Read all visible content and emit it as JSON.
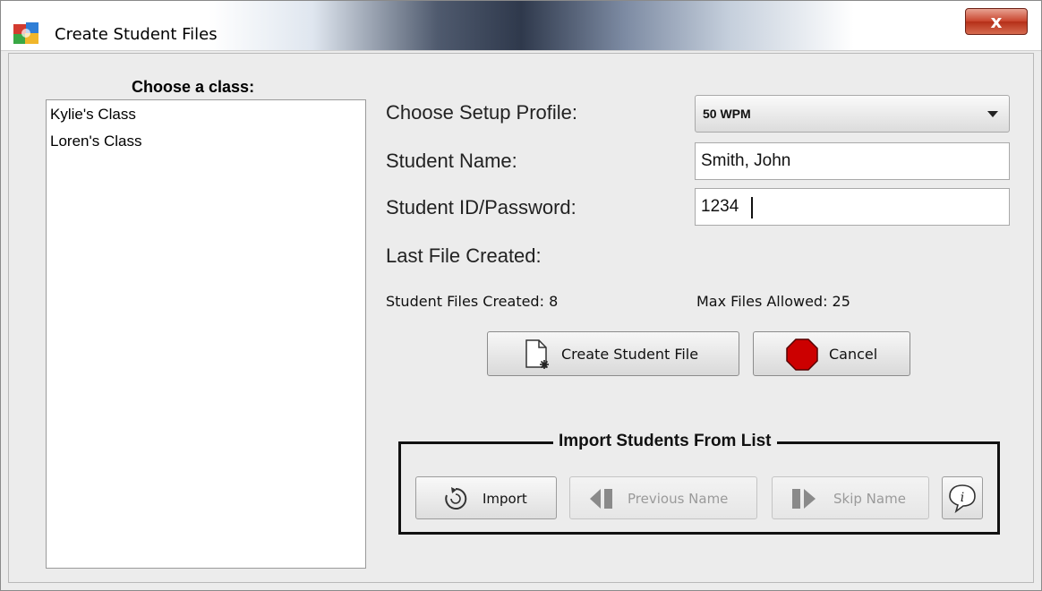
{
  "window": {
    "title": "Create Student Files",
    "close_label": "x"
  },
  "classes": {
    "heading": "Choose a class:",
    "items": [
      "Kylie's Class",
      "Loren's Class"
    ]
  },
  "form": {
    "profile_label": "Choose Setup Profile:",
    "profile_value": "50 WPM",
    "name_label": "Student Name:",
    "name_value": "Smith, John",
    "id_label": "Student ID/Password:",
    "id_value": "1234",
    "last_file_label": "Last File Created:",
    "files_created": "Student Files Created: 8",
    "max_files": "Max Files Allowed: 25"
  },
  "actions": {
    "create_label": "Create Student File",
    "cancel_label": "Cancel"
  },
  "import_group": {
    "title": "Import Students From List",
    "import_label": "Import",
    "previous_label": "Previous Name",
    "skip_label": "Skip Name"
  },
  "colors": {
    "cancel_red": "#cc0000",
    "close_red": "#c8432b"
  },
  "icons": {
    "app": "app-icon",
    "close": "close-icon",
    "dropdown": "chevron-down-icon",
    "new_file": "new-file-icon",
    "stop": "stop-sign-icon",
    "import": "refresh-icon",
    "previous": "previous-icon",
    "skip": "skip-icon",
    "info": "info-bubble-icon"
  }
}
